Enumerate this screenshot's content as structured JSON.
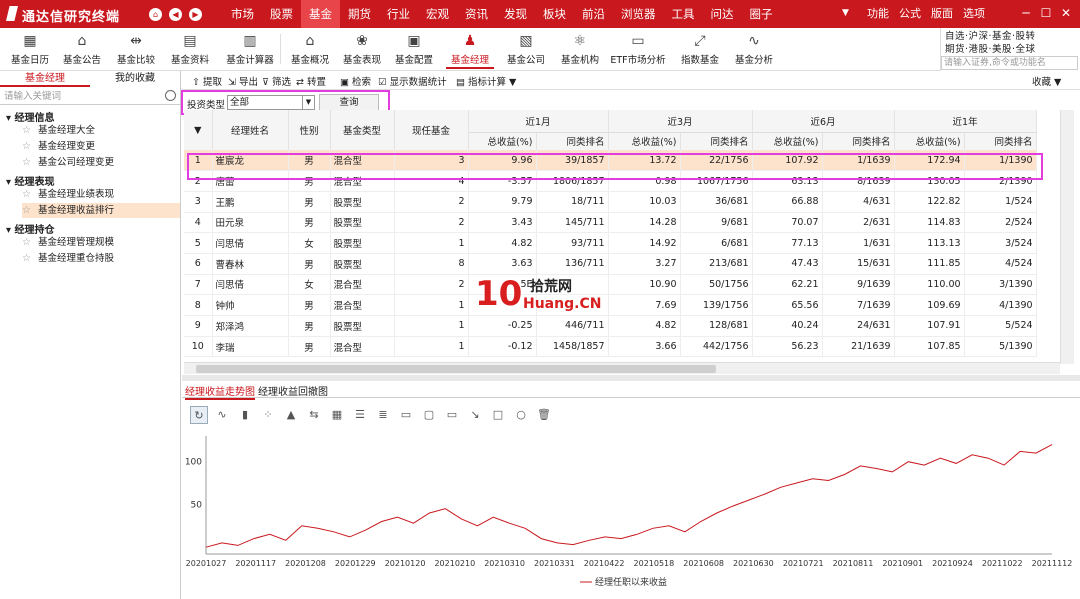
{
  "app": {
    "title": "通达信研究终端"
  },
  "main_menu": [
    "市场",
    "股票",
    "基金",
    "期货",
    "行业",
    "宏观",
    "资讯",
    "发现",
    "板块",
    "前沿",
    "浏览器",
    "工具",
    "问达",
    "圈子"
  ],
  "right_menu": [
    "功能",
    "公式",
    "版面",
    "选项"
  ],
  "toolbar": [
    "基金日历",
    "基金公告",
    "基金比较",
    "基金资料",
    "基金计算器",
    "基金概况",
    "基金表现",
    "基金配置",
    "基金经理",
    "基金公司",
    "基金机构",
    "ETF市场分析",
    "指数基金",
    "基金分析"
  ],
  "quick_links": {
    "line1": "自选·沪深·基金·股转",
    "line2": "期货·港股·美股·全球",
    "placeholder": "请输入证券,命令或功能名"
  },
  "left_tabs": [
    "基金经理",
    "我的收藏"
  ],
  "left_search_placeholder": "请输入关键词",
  "tree": [
    {
      "group": "经理信息",
      "items": [
        "基金经理大全",
        "基金经理变更",
        "基金公司经理变更"
      ]
    },
    {
      "group": "经理表现",
      "items": [
        "基金经理业绩表现",
        "基金经理收益排行"
      ]
    },
    {
      "group": "经理持仓",
      "items": [
        "基金经理管理规模",
        "基金经理重仓持股"
      ]
    }
  ],
  "grid_toolbar": [
    "提取",
    "导出",
    "筛选",
    "转置",
    "检索",
    "显示数据统计",
    "指标计算 ▼"
  ],
  "collect": "收藏 ▼",
  "filter": {
    "label": "投资类型",
    "value": "全部",
    "button": "查询"
  },
  "table": {
    "headers": [
      "经理姓名",
      "性别",
      "基金类型",
      "现任基金"
    ],
    "periods": [
      "近1月",
      "近3月",
      "近6月",
      "近1年"
    ],
    "subheaders": [
      "总收益(%)",
      "同类排名"
    ],
    "rows": [
      [
        "1",
        "崔宸龙",
        "男",
        "混合型",
        "3",
        "9.96",
        "39/1857",
        "13.72",
        "22/1756",
        "107.92",
        "1/1639",
        "172.94",
        "1/1390"
      ],
      [
        "2",
        "唐蕾",
        "男",
        "混合型",
        "4",
        "-3.57",
        "1806/1857",
        "0.98",
        "1067/1756",
        "63.13",
        "8/1639",
        "130.05",
        "2/1390"
      ],
      [
        "3",
        "王鹏",
        "男",
        "股票型",
        "2",
        "9.79",
        "18/711",
        "10.03",
        "36/681",
        "66.88",
        "4/631",
        "122.82",
        "1/524"
      ],
      [
        "4",
        "田元泉",
        "男",
        "股票型",
        "2",
        "3.43",
        "145/711",
        "14.28",
        "9/681",
        "70.07",
        "2/631",
        "114.83",
        "2/524"
      ],
      [
        "5",
        "闫思倩",
        "女",
        "股票型",
        "1",
        "4.82",
        "93/711",
        "14.92",
        "6/681",
        "77.13",
        "1/631",
        "113.13",
        "3/524"
      ],
      [
        "6",
        "曹春林",
        "男",
        "股票型",
        "8",
        "3.63",
        "136/711",
        "3.27",
        "213/681",
        "47.43",
        "15/631",
        "111.85",
        "4/524"
      ],
      [
        "7",
        "闫思倩",
        "女",
        "混合型",
        "2",
        "5E",
        "",
        "10.90",
        "50/1756",
        "62.21",
        "9/1639",
        "110.00",
        "3/1390"
      ],
      [
        "8",
        "钟帅",
        "男",
        "混合型",
        "1",
        "",
        "",
        "7.69",
        "139/1756",
        "65.56",
        "7/1639",
        "109.69",
        "4/1390"
      ],
      [
        "9",
        "郑泽鸿",
        "男",
        "股票型",
        "1",
        "-0.25",
        "446/711",
        "4.82",
        "128/681",
        "40.24",
        "24/631",
        "107.91",
        "5/524"
      ],
      [
        "10",
        "李瑞",
        "男",
        "混合型",
        "1",
        "-0.12",
        "1458/1857",
        "3.66",
        "442/1756",
        "56.23",
        "21/1639",
        "107.85",
        "5/1390"
      ]
    ]
  },
  "watermark": {
    "text1": "拾荒网",
    "text2": "Huang.CN"
  },
  "bottom_tabs": [
    "经理收益走势图",
    "经理收益回撤图"
  ],
  "chart_data": {
    "type": "line",
    "x_ticks": [
      "20201027",
      "20201117",
      "20201208",
      "20201229",
      "20210120",
      "20210210",
      "20210310",
      "20210331",
      "20210422",
      "20210518",
      "20210608",
      "20210630",
      "20210721",
      "20210811",
      "20210901",
      "20210924",
      "20211022",
      "20211112"
    ],
    "y_ticks": [
      50,
      100
    ],
    "ylim": [
      -8,
      130
    ],
    "series": [
      {
        "name": "经理任职以来收益",
        "color": "#c9181e",
        "values": [
          0,
          5,
          2,
          10,
          15,
          8,
          25,
          22,
          18,
          12,
          20,
          30,
          35,
          28,
          40,
          45,
          33,
          25,
          35,
          28,
          22,
          10,
          5,
          3,
          8,
          12,
          10,
          15,
          22,
          25,
          18,
          30,
          40,
          48,
          55,
          62,
          70,
          75,
          80,
          78,
          85,
          95,
          92,
          88,
          100,
          96,
          104,
          98,
          108,
          104,
          96,
          112,
          110,
          120
        ]
      }
    ]
  }
}
